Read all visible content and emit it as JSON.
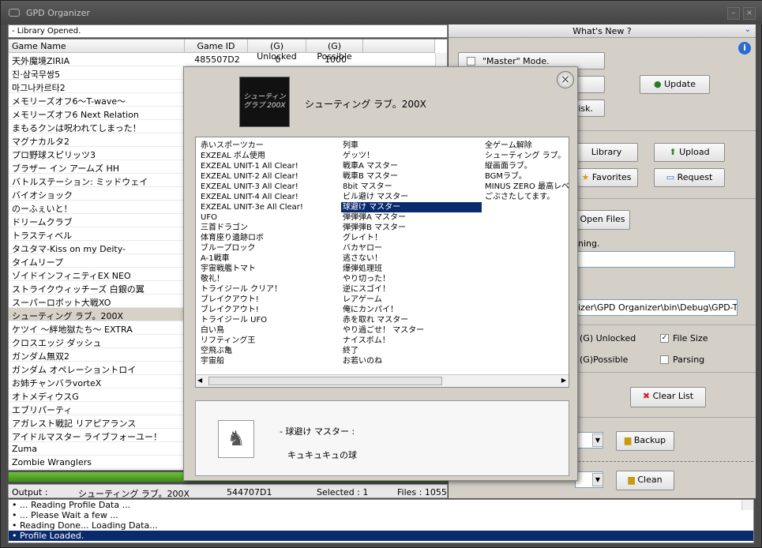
{
  "window": {
    "title": "GPD Organizer"
  },
  "status_top": "- Library Opened.",
  "grid": {
    "headers": [
      "Game Name",
      "Game ID",
      "(G) Unlocked",
      "(G) Possible"
    ],
    "rows": [
      {
        "name": "天外魔境ZIRIA",
        "id": "485507D2",
        "unlocked": "0",
        "possible": "1000"
      },
      {
        "name": "진·삼국무쌍5",
        "id": "",
        "unlocked": "",
        "possible": ""
      },
      {
        "name": "마그나카르타2",
        "id": "",
        "unlocked": "",
        "possible": ""
      },
      {
        "name": "メモリーズオフ6〜T-wave〜",
        "id": "",
        "unlocked": "",
        "possible": ""
      },
      {
        "name": "メモリーズオフ6 Next Relation",
        "id": "",
        "unlocked": "",
        "possible": ""
      },
      {
        "name": "まもるクンは呪われてしまった！",
        "id": "",
        "unlocked": "",
        "possible": ""
      },
      {
        "name": "マグナカルタ2",
        "id": "",
        "unlocked": "",
        "possible": ""
      },
      {
        "name": "プロ野球スピリッツ3",
        "id": "",
        "unlocked": "",
        "possible": ""
      },
      {
        "name": "ブラザー イン アームズ HH",
        "id": "",
        "unlocked": "",
        "possible": ""
      },
      {
        "name": "バトルステーション: ミッドウェイ",
        "id": "",
        "unlocked": "",
        "possible": ""
      },
      {
        "name": "バイオショック",
        "id": "",
        "unlocked": "",
        "possible": ""
      },
      {
        "name": "のーふぇいと！",
        "id": "",
        "unlocked": "",
        "possible": ""
      },
      {
        "name": "ドリームクラブ",
        "id": "",
        "unlocked": "",
        "possible": ""
      },
      {
        "name": "トラスティベル",
        "id": "",
        "unlocked": "",
        "possible": ""
      },
      {
        "name": "タユタマ-Kiss on my Deity-",
        "id": "",
        "unlocked": "",
        "possible": ""
      },
      {
        "name": "タイムリープ",
        "id": "",
        "unlocked": "",
        "possible": ""
      },
      {
        "name": "ゾイドインフィニティEX NEO",
        "id": "",
        "unlocked": "",
        "possible": ""
      },
      {
        "name": "ストライクウィッチーズ 白銀の翼",
        "id": "",
        "unlocked": "",
        "possible": ""
      },
      {
        "name": "スーパーロボット大戦XO",
        "id": "",
        "unlocked": "",
        "possible": ""
      },
      {
        "name": "シューティング ラブ。200X",
        "id": "",
        "unlocked": "",
        "possible": ""
      },
      {
        "name": "ケツイ 〜絆地獄たち〜 EXTRA",
        "id": "",
        "unlocked": "",
        "possible": ""
      },
      {
        "name": "クロスエッジ ダッシュ",
        "id": "",
        "unlocked": "",
        "possible": ""
      },
      {
        "name": "ガンダム無双2",
        "id": "",
        "unlocked": "",
        "possible": ""
      },
      {
        "name": "ガンダム オペレーショントロイ",
        "id": "",
        "unlocked": "",
        "possible": ""
      },
      {
        "name": "お姉チャンバラvorteX",
        "id": "",
        "unlocked": "",
        "possible": ""
      },
      {
        "name": "オトメディウスG",
        "id": "",
        "unlocked": "",
        "possible": ""
      },
      {
        "name": "エブリパーティ",
        "id": "",
        "unlocked": "",
        "possible": ""
      },
      {
        "name": "アガレスト戦記 リアピアランス",
        "id": "",
        "unlocked": "",
        "possible": ""
      },
      {
        "name": "アイドルマスター ライブフォーユー！",
        "id": "",
        "unlocked": "",
        "possible": ""
      },
      {
        "name": "Zuma",
        "id": "",
        "unlocked": "",
        "possible": ""
      },
      {
        "name": "Zombie Wranglers",
        "id": "",
        "unlocked": "",
        "possible": ""
      }
    ],
    "selected_index": 19
  },
  "output": {
    "label": "Output :",
    "game": "シューティング ラブ。200X",
    "id": "544707D1",
    "selected": "Selected : 1",
    "files": "Files : 1055"
  },
  "log": [
    "• ... Reading Profile Data ...",
    "• ... Please Wait a few ...",
    "• Reading Done... Loading Data...",
    "• Profile Loaded."
  ],
  "right": {
    "whats_new": "What's New ?",
    "master_mode": "\"Master\" Mode.",
    "disk_label": "isk.",
    "update": "Update",
    "library": "Library",
    "upload": "Upload",
    "favorites": "Favorites",
    "request": "Request",
    "open_files": "Open Files",
    "ning_label": "ning.",
    "path_value": "izer\\GPD Organizer\\bin\\Debug\\GPD-Trash",
    "g_unlocked": "(G) Unlocked",
    "file_size": "File Size",
    "g_possible": "(G)Possible",
    "parsing": "Parsing",
    "clear_list": "Clear List",
    "backup": "Backup",
    "clean": "Clean"
  },
  "dialog": {
    "title": "シューティング ラブ。200X",
    "thumb_text": "シューティングラブ 200X",
    "columns": [
      [
        "赤いスポーツカー",
        "EXZEAL ボム使用",
        "EXZEAL UNIT-1 All Clear!",
        "EXZEAL UNIT-2 All Clear!",
        "EXZEAL UNIT-3 All Clear!",
        "EXZEAL UNIT-4 All Clear!",
        "EXZEAL UNIT-3e All Clear!",
        "UFO",
        "三首ドラゴン",
        "体育座り遺跡ロボ",
        "ブループロック",
        "A-1戦車",
        "宇宙戦艦トマト",
        "敬礼！",
        "トライジール クリア！",
        "ブレイクアウト!",
        "ブレイクアウト!",
        "トライジール UFO",
        "白い鳥",
        "リフティング王",
        "空飛ぶ亀",
        "宇宙船"
      ],
      [
        "列車",
        "ゲッツ！",
        "戦車A マスター",
        "戦車B マスター",
        "8bit マスター",
        "ビル避け マスター",
        "球避け マスター",
        "弾弾弾A マスター",
        "弾弾弾B マスター",
        "グレイト！",
        "バカヤロー",
        "逃さない！",
        "爆弾処理班",
        "やり切った！",
        "逆にスゴイ！",
        "レアゲーム",
        "俺にカンパイ！",
        "赤を取れ マスター",
        "やり過ごせ！ マスター",
        "ナイスボム！",
        "終了",
        "お若いのね"
      ],
      [
        "全ゲーム解除",
        "シューティング ラブ。",
        "縦画面ラブ。",
        "BGMラブ。",
        "MINUS ZERO 最高レベ",
        "ごぶさたしてます。"
      ]
    ],
    "highlight": "球避け マスター",
    "detail_name": "- 球避け マスター :",
    "detail_desc": "キュキュキュの球"
  }
}
